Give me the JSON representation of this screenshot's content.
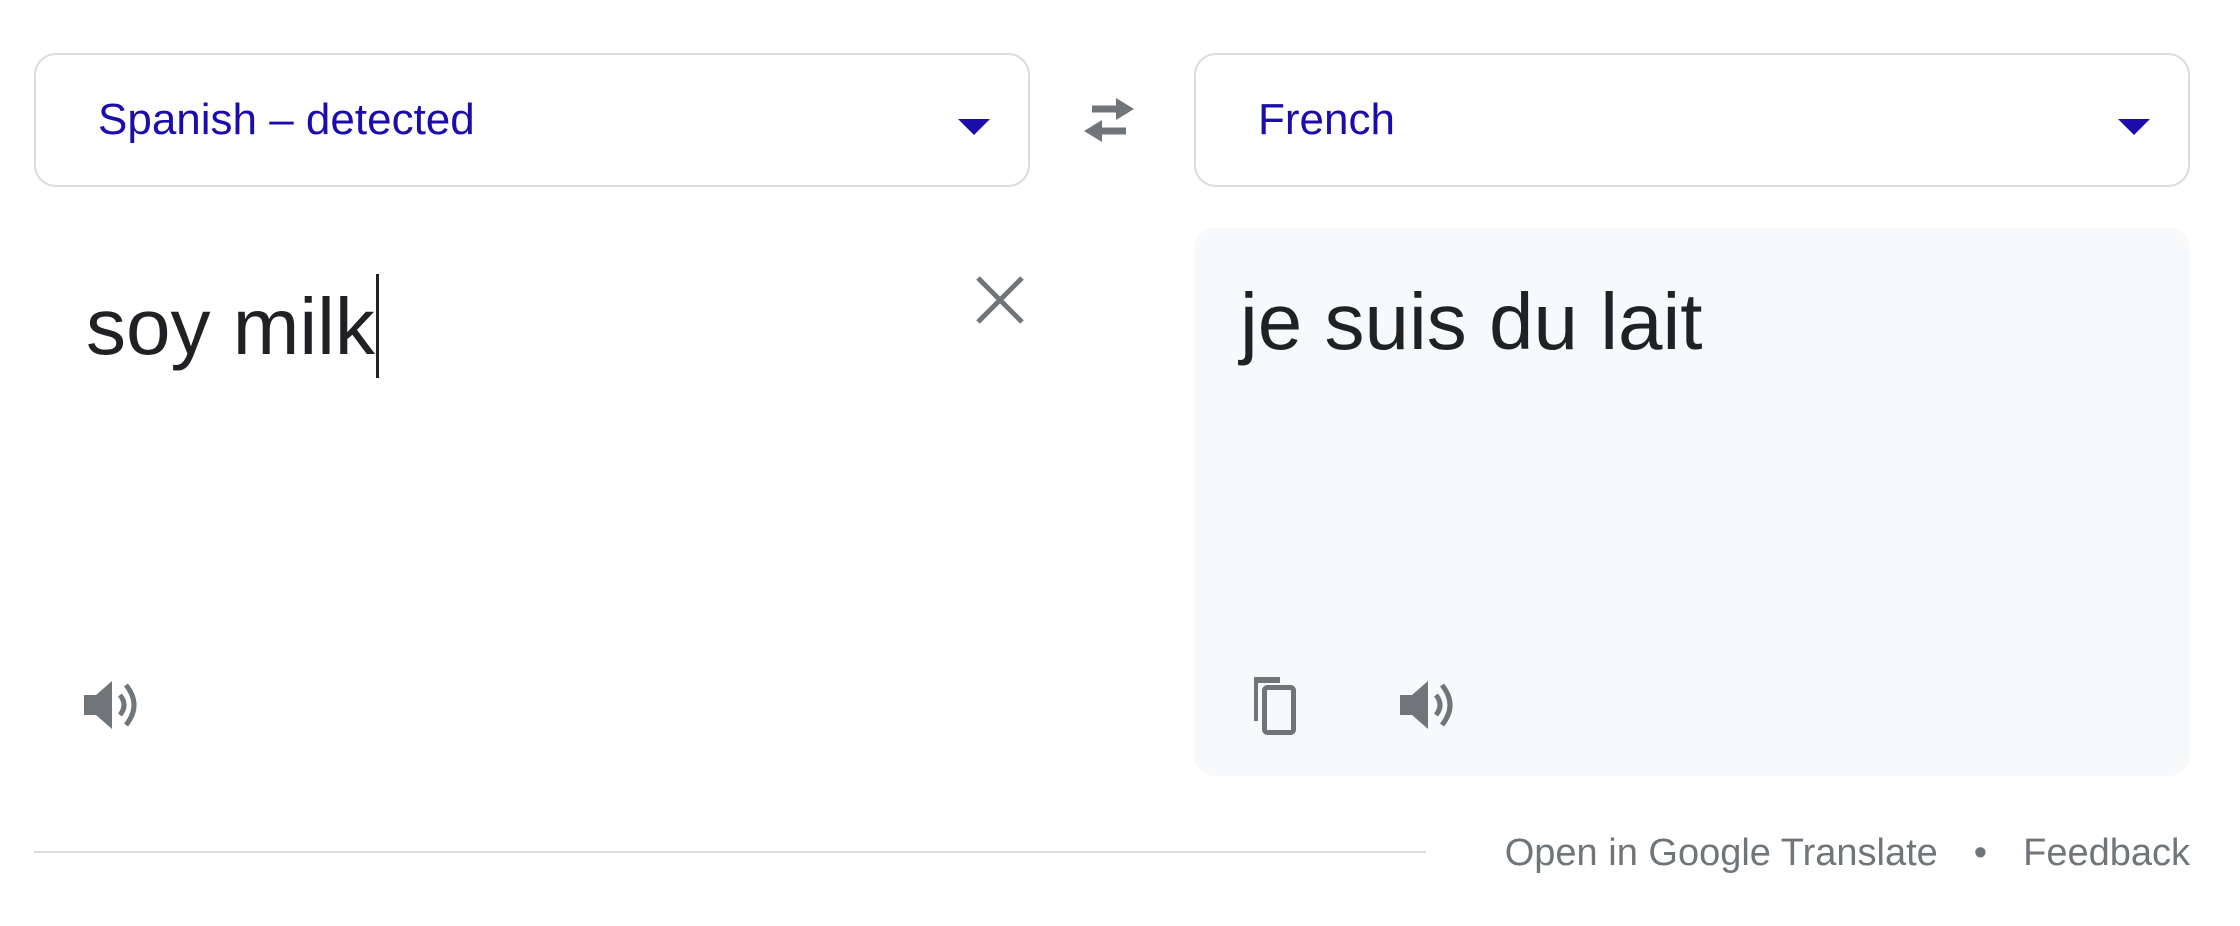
{
  "source_language": {
    "label": "Spanish – detected"
  },
  "target_language": {
    "label": "French"
  },
  "source": {
    "text": "soy milk"
  },
  "target": {
    "text": "je suis du lait"
  },
  "footer": {
    "open_link": "Open in Google Translate",
    "separator": "•",
    "feedback_link": "Feedback"
  },
  "icons": {
    "swap": "swap-arrows-icon",
    "clear": "close-icon",
    "listen": "speaker-icon",
    "copy": "copy-icon",
    "dropdown": "caret-down-icon"
  },
  "colors": {
    "language_text": "#1a0dab",
    "icon_gray": "#70757a",
    "border": "#dadce0",
    "target_background": "#f8f9fa",
    "body_text": "#202124"
  }
}
